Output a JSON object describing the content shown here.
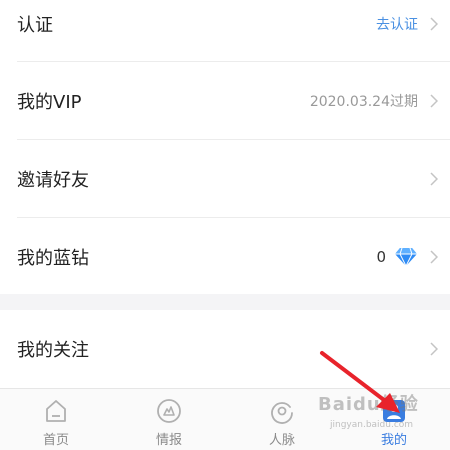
{
  "menu": {
    "certification": {
      "label": "认证",
      "value": "去认证"
    },
    "vip": {
      "label": "我的VIP",
      "value": "2020.03.24过期"
    },
    "invite": {
      "label": "邀请好友"
    },
    "blue_diamond": {
      "label": "我的蓝钻",
      "value": "0",
      "icon": "diamond-icon"
    },
    "following": {
      "label": "我的关注"
    }
  },
  "tabbar": {
    "tabs": [
      {
        "label": "首页",
        "icon": "home-icon"
      },
      {
        "label": "情报",
        "icon": "intel-icon"
      },
      {
        "label": "人脉",
        "icon": "network-icon"
      },
      {
        "label": "我的",
        "icon": "profile-icon",
        "active": true
      }
    ]
  },
  "watermark": {
    "text": "Baidu经验",
    "sub": "jingyan.baidu.com"
  },
  "colors": {
    "accent": "#3a7de0",
    "link": "#4a90e2",
    "arrow": "#e8232b",
    "diamond": "#2f8cf5"
  }
}
